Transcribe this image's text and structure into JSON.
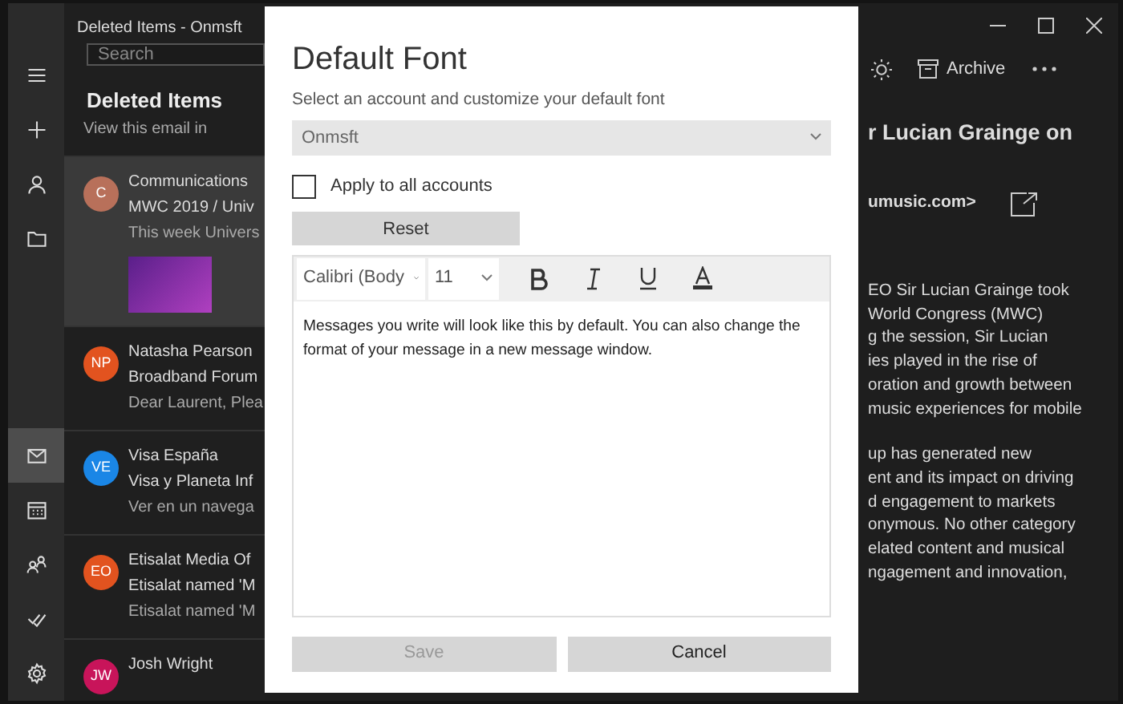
{
  "window": {
    "title": "Deleted Items - Onmsft"
  },
  "rail": [
    {
      "kind": "menu",
      "selected": false
    },
    {
      "kind": "plus",
      "selected": false
    },
    {
      "kind": "person",
      "selected": false
    },
    {
      "kind": "folder",
      "selected": false
    },
    {
      "kind": "mail",
      "selected": true
    },
    {
      "kind": "calendar",
      "selected": false
    },
    {
      "kind": "people",
      "selected": false
    },
    {
      "kind": "check",
      "selected": false
    },
    {
      "kind": "settings",
      "selected": false
    }
  ],
  "mail_list": {
    "search": {
      "placeholder": "Search"
    },
    "heading": "Deleted Items",
    "messages": [
      {
        "lines": [
          "View this email in"
        ],
        "selected": false
      },
      {
        "initials": "C",
        "color": "#b8705a",
        "lines": [
          "Communications",
          "MWC 2019 / Univ",
          "This week Univers"
        ],
        "thumbnail": true,
        "selected": true
      },
      {
        "initials": "NP",
        "color": "#e2531f",
        "lines": [
          "Natasha Pearson",
          "Broadband Forum",
          "Dear Laurent, Plea"
        ],
        "selected": false
      },
      {
        "initials": "VE",
        "color": "#1a86e6",
        "lines": [
          "Visa España",
          "Visa y Planeta Inf",
          "Ver en un navega"
        ],
        "selected": false
      },
      {
        "initials": "EO",
        "color": "#e2531f",
        "lines": [
          "Etisalat Media Of",
          "Etisalat named 'M",
          "Etisalat named 'M"
        ],
        "selected": false
      },
      {
        "initials": "JW",
        "color": "#c8145a",
        "lines": [
          "Josh Wright"
        ],
        "selected": false
      }
    ]
  },
  "reading_pane": {
    "toolbar": {
      "archive": "Archive"
    },
    "subject": "r Lucian Grainge on",
    "sender": "umusic.com>",
    "paragraphs": [
      [
        "EO Sir Lucian Grainge took",
        "World Congress (MWC)",
        "g the session, Sir Lucian",
        "ies played in the rise of",
        "oration and growth between",
        "music experiences for mobile"
      ],
      [
        "up has generated new",
        "ent and its impact on driving",
        "d engagement to markets",
        "onymous. No other category",
        "elated content and musical",
        "ngagement and innovation,"
      ]
    ]
  },
  "dialog": {
    "title": "Default Font",
    "subtitle": "Select an account and customize your default font",
    "account": {
      "value": "Onmsft"
    },
    "apply_all": {
      "label": "Apply to all accounts",
      "checked": false
    },
    "reset": "Reset",
    "editor": {
      "font": "Calibri (Body",
      "size": "11",
      "sample": "Messages you write will look like this by default. You can also change the format of your message in a new message window."
    },
    "buttons": [
      {
        "label": "Save",
        "disabled": true
      },
      {
        "label": "Cancel",
        "disabled": false
      }
    ]
  }
}
